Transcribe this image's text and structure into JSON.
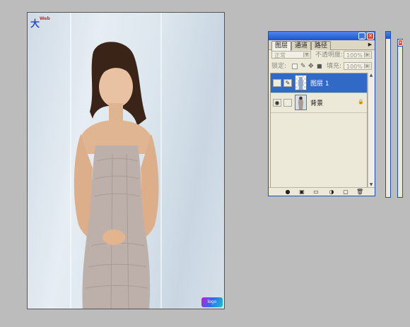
{
  "document": {
    "logo_top": "大",
    "logo_top_small": "Web",
    "logo_bottom": "logo"
  },
  "layers_panel": {
    "tabs": [
      "图层",
      "通道",
      "路径"
    ],
    "blend_mode": "正常",
    "opacity_label": "不透明度:",
    "opacity_value": "100%",
    "lock_label": "锁定:",
    "fill_label": "填充:",
    "fill_value": "100%",
    "layers": [
      {
        "name": "图层 1",
        "selected": true,
        "visible": false
      },
      {
        "name": "背景",
        "selected": false,
        "visible": true,
        "locked": true
      }
    ],
    "bottom_icons": [
      "link-icon",
      "layer-style-icon",
      "mask-icon",
      "new-set-icon",
      "adjustment-icon",
      "new-layer-icon",
      "trash-icon"
    ]
  },
  "colors": {
    "titlebar": "#1c55cf",
    "selected_layer": "#3169c6",
    "panel_bg": "#ece9d8",
    "workspace": "#bcbcbc"
  }
}
